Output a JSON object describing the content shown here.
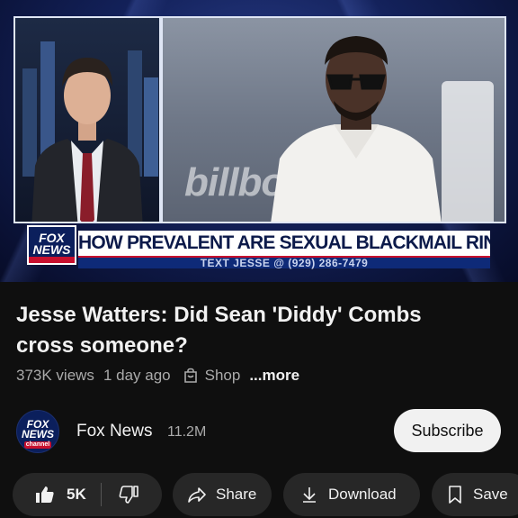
{
  "video": {
    "chyron_logo_line1": "FOX",
    "chyron_logo_line2": "NEWS",
    "headline": "HOW PREVALENT ARE SEXUAL BLACKMAIL RINGS?",
    "ticker": "TEXT JESSE @ (929) 286-7479",
    "backdrop_text": "billbo"
  },
  "video_info": {
    "title": "Jesse Watters: Did Sean 'Diddy' Combs cross someone?",
    "views": "373K views",
    "age": "1 day ago",
    "shop_label": "Shop",
    "more_label": "...more"
  },
  "channel": {
    "avatar_line1": "FOX",
    "avatar_line2": "NEWS",
    "avatar_line3": "channel",
    "name": "Fox News",
    "subscribers": "11.2M",
    "subscribe_label": "Subscribe"
  },
  "actions": {
    "like_count": "5K",
    "share_label": "Share",
    "download_label": "Download",
    "save_label": "Save"
  },
  "colors": {
    "background": "#0f0f0f",
    "pill": "#272727",
    "subscribe_bg": "#f1f1f1",
    "fox_blue": "#0b1f5c",
    "fox_red": "#c8102e"
  },
  "icons": [
    "like-icon",
    "dislike-icon",
    "share-icon",
    "download-icon",
    "save-icon",
    "shop-icon"
  ]
}
